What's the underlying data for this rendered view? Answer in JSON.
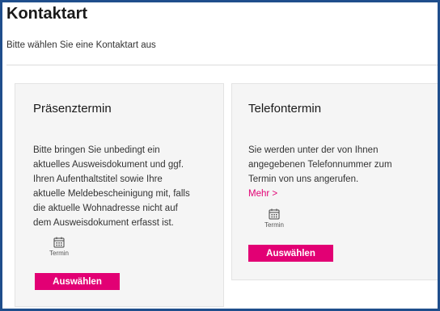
{
  "page": {
    "title": "Kontaktart",
    "subtitle": "Bitte wählen Sie eine Kontaktart aus"
  },
  "colors": {
    "accent": "#e20074",
    "frame": "#1f4e8c",
    "card_background": "#f5f5f5"
  },
  "cards": [
    {
      "title": "Präsenztermin",
      "text_lines": [
        "Bitte bringen Sie unbedingt ein",
        "aktuelles Ausweisdokument und ggf.",
        "Ihren Aufenthaltstitel sowie Ihre",
        "aktuelle Meldebescheinigung mit, falls",
        "die aktuelle Wohnadresse nicht auf",
        "dem Ausweisdokument erfasst ist."
      ],
      "icon": "calendar-icon",
      "icon_label": "Termin",
      "button_label": "Auswählen"
    },
    {
      "title": "Telefontermin",
      "text_lines": [
        "Sie werden unter der von Ihnen",
        "angegebenen Telefonnummer zum",
        "Termin von uns angerufen."
      ],
      "more_link": "Mehr >",
      "icon": "calendar-icon",
      "icon_label": "Termin",
      "button_label": "Auswählen"
    }
  ]
}
